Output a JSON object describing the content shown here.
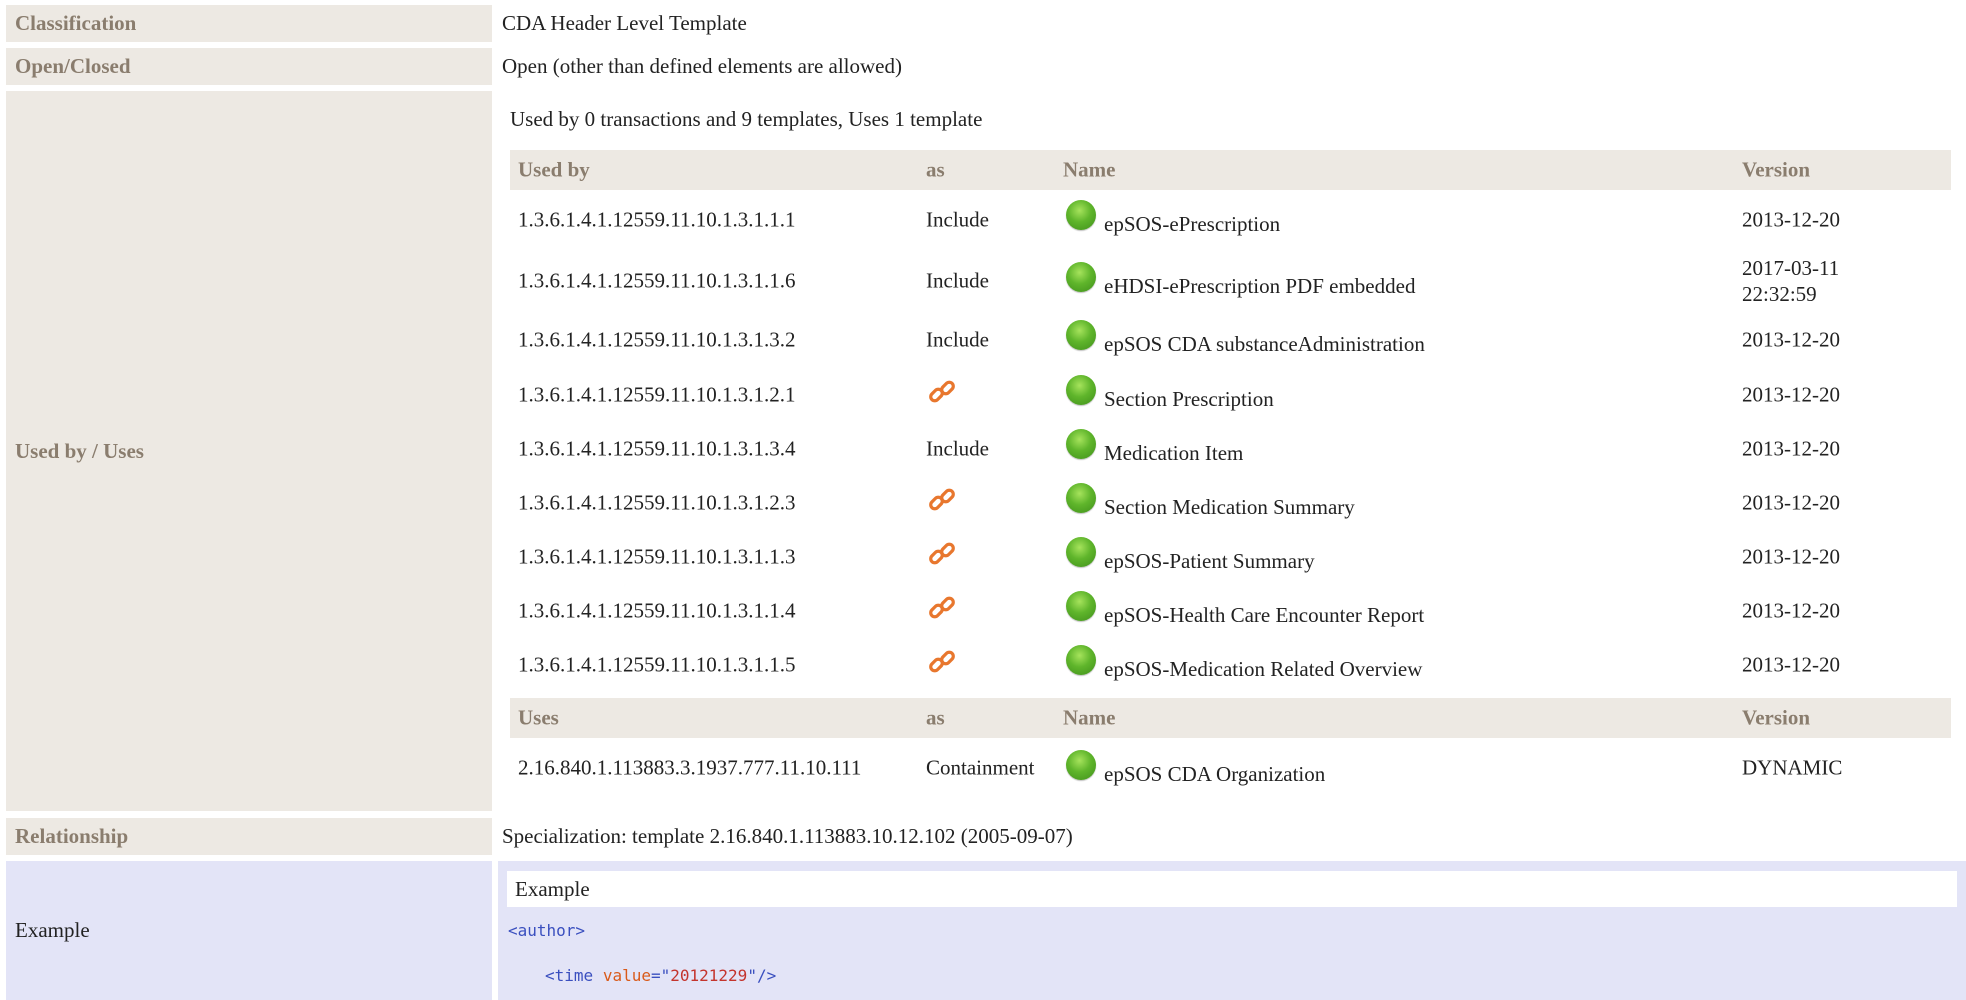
{
  "rows": {
    "classification": {
      "label": "Classification",
      "value": "CDA Header Level Template"
    },
    "open_closed": {
      "label": "Open/Closed",
      "value": "Open (other than defined elements are allowed)"
    },
    "used_by_uses": {
      "label": "Used by / Uses",
      "summary": "Used by 0 transactions and 9 templates, Uses 1 template",
      "used_by_header": {
        "col1": "Used by",
        "col2": "as",
        "col3": "Name",
        "col4": "Version"
      },
      "used_by": [
        {
          "oid": "1.3.6.1.4.1.12559.11.10.1.3.1.1.1",
          "as": "Include",
          "name": "epSOS-ePrescription",
          "version": "2013-12-20",
          "status": "active"
        },
        {
          "oid": "1.3.6.1.4.1.12559.11.10.1.3.1.1.6",
          "as": "Include",
          "name": "eHDSI-ePrescription PDF embedded",
          "version_line1": "2017-03-11",
          "version_line2": "22:32:59",
          "status": "active"
        },
        {
          "oid": "1.3.6.1.4.1.12559.11.10.1.3.1.3.2",
          "as": "Include",
          "name": "epSOS CDA substanceAdministration",
          "version": "2013-12-20",
          "status": "active"
        },
        {
          "oid": "1.3.6.1.4.1.12559.11.10.1.3.1.2.1",
          "as_icon": "link-icon",
          "name": "Section Prescription",
          "version": "2013-12-20",
          "status": "active"
        },
        {
          "oid": "1.3.6.1.4.1.12559.11.10.1.3.1.3.4",
          "as": "Include",
          "name": "Medication Item",
          "version": "2013-12-20",
          "status": "active"
        },
        {
          "oid": "1.3.6.1.4.1.12559.11.10.1.3.1.2.3",
          "as_icon": "link-icon",
          "name": "Section Medication Summary",
          "version": "2013-12-20",
          "status": "active"
        },
        {
          "oid": "1.3.6.1.4.1.12559.11.10.1.3.1.1.3",
          "as_icon": "link-icon",
          "name": "epSOS-Patient Summary",
          "version": "2013-12-20",
          "status": "active"
        },
        {
          "oid": "1.3.6.1.4.1.12559.11.10.1.3.1.1.4",
          "as_icon": "link-icon",
          "name": "epSOS-Health Care Encounter Report",
          "version": "2013-12-20",
          "status": "active"
        },
        {
          "oid": "1.3.6.1.4.1.12559.11.10.1.3.1.1.5",
          "as_icon": "link-icon",
          "name": "epSOS-Medication Related Overview",
          "version": "2013-12-20",
          "status": "active"
        }
      ],
      "uses_header": {
        "col1": "Uses",
        "col2": "as",
        "col3": "Name",
        "col4": "Version"
      },
      "uses": [
        {
          "oid": "2.16.840.1.113883.3.1937.777.11.10.111",
          "as": "Containment",
          "name": "epSOS CDA Organization",
          "version": "DYNAMIC",
          "status": "active"
        }
      ]
    },
    "relationship": {
      "label": "Relationship",
      "value": "Specialization: template 2.16.840.1.113883.10.12.102 (2005-09-07)"
    },
    "example": {
      "label": "Example",
      "title": "Example",
      "code_line1": "<author>",
      "code_line2_tag_open": "<time",
      "code_line2_attr": "value",
      "code_line2_eq": "=\"",
      "code_line2_str": "20121229",
      "code_line2_close": "\"/>"
    }
  },
  "colors": {
    "label_bg": "#ede9e3",
    "label_text": "#8a7d6e",
    "example_bg": "#e3e4f7",
    "status_active": "#5fb52b",
    "link_icon": "#e8772e"
  }
}
